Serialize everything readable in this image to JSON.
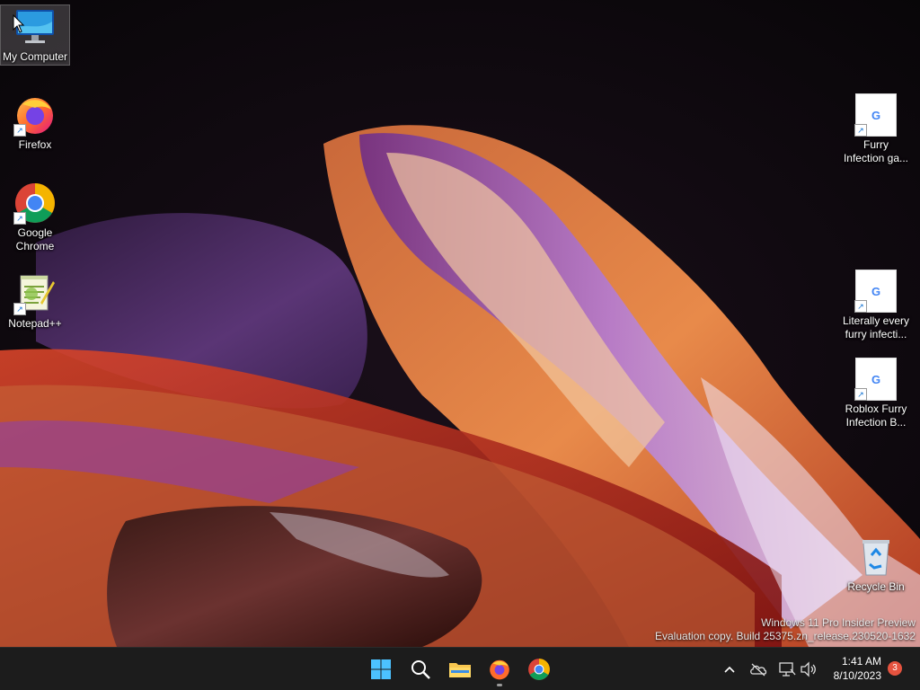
{
  "desktop_icons_left": [
    {
      "label": "My Computer"
    },
    {
      "label": "Firefox"
    },
    {
      "label": "Google Chrome"
    },
    {
      "label": "Notepad++"
    }
  ],
  "desktop_icons_right": [
    {
      "label": "Furry Infection ga..."
    },
    {
      "label": "Literally every furry infecti..."
    },
    {
      "label": "Roblox Furry Infection B..."
    },
    {
      "label": "Recycle Bin"
    }
  ],
  "watermark": {
    "line1": "Windows 11 Pro Insider Preview",
    "line2": "Evaluation copy. Build 25375.zn_release.230520-1632"
  },
  "taskbar": {
    "apps": [
      {
        "icon": "windows-start-icon"
      },
      {
        "icon": "search-icon"
      },
      {
        "icon": "file-explorer-icon"
      },
      {
        "icon": "firefox-icon"
      },
      {
        "icon": "chrome-icon"
      }
    ],
    "clock": {
      "time": "1:41 AM",
      "date": "8/10/2023"
    },
    "notification_count": "3"
  },
  "colors": {
    "taskbar_bg": "#1c1c1c",
    "accent": "#0078d4",
    "badge": "#e5533f"
  }
}
